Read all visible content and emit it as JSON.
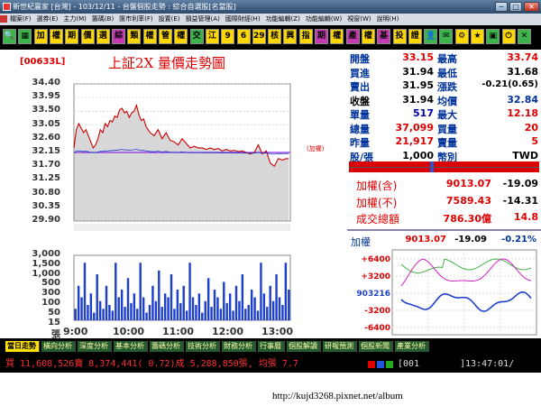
{
  "window": {
    "title": "新世紀贏家 [台灣] - 103/12/11 - 台盤個股走勢 : 綜合自選股[名當股]"
  },
  "menu": [
    "檔案(F)",
    "選券(E)",
    "主力(M)",
    "籌碼(B)",
    "匯市利率(F)",
    "設置(E)",
    "損益管理(A)",
    "國際財經(H)",
    "功能編輯(Z)",
    "功能編輯(W)",
    "視窗(W)",
    "說明(H)"
  ],
  "toolbar": [
    {
      "label": "🔍",
      "color": "#3cb44b",
      "icon": "search-icon"
    },
    {
      "label": "▦",
      "color": "#3cb44b",
      "icon": "grid-icon"
    },
    {
      "label": "加",
      "color": "#ffd700"
    },
    {
      "label": "權",
      "color": "#ffd700"
    },
    {
      "label": "期",
      "color": "#ffd700"
    },
    {
      "label": "價",
      "color": "#ffd700"
    },
    {
      "label": "選",
      "color": "#ffd700"
    },
    {
      "label": "綜",
      "color": "#c43bb0"
    },
    {
      "label": "類",
      "color": "#ffd700"
    },
    {
      "label": "權",
      "color": "#ffd700"
    },
    {
      "label": "管",
      "color": "#ffd700"
    },
    {
      "label": "權",
      "color": "#ffd700"
    },
    {
      "label": "交",
      "color": "#3cb44b"
    },
    {
      "label": "江",
      "color": "#ffd700"
    },
    {
      "label": "9",
      "color": "#ffd700"
    },
    {
      "label": "6",
      "color": "#ffd700"
    },
    {
      "label": "29",
      "color": "#ffd700"
    },
    {
      "label": "核",
      "color": "#ffd700"
    },
    {
      "label": "興",
      "color": "#ffd700"
    },
    {
      "label": "指",
      "color": "#ffd700"
    },
    {
      "label": "期",
      "color": "#c43bb0"
    },
    {
      "label": "權",
      "color": "#ffd700"
    },
    {
      "label": "產",
      "color": "#c43bb0"
    },
    {
      "label": "權",
      "color": "#ffd700"
    },
    {
      "label": "基",
      "color": "#c43bb0"
    },
    {
      "label": "投",
      "color": "#ffd700"
    },
    {
      "label": "證",
      "color": "#ffd700"
    },
    {
      "label": "👤",
      "color": "#3cb44b",
      "icon": "user-icon"
    },
    {
      "label": "✉",
      "color": "#3cb44b",
      "icon": "mail-icon"
    },
    {
      "label": "⚙",
      "color": "#ffd700",
      "icon": "gear-icon"
    },
    {
      "label": "★",
      "color": "#ffd700",
      "icon": "star-icon"
    },
    {
      "label": "▣",
      "color": "#3cb44b",
      "icon": "window-icon"
    },
    {
      "label": "⏻",
      "color": "#ffd700",
      "icon": "power-icon"
    },
    {
      "label": "✕",
      "color": "#3cb44b",
      "icon": "close-icon"
    }
  ],
  "chart_panel": {
    "code": "00633L",
    "title": "上証2X  量價走勢圖",
    "ref_label": "(加權)"
  },
  "quote": [
    {
      "label": "開盤",
      "value": "33.15",
      "color": "#d00",
      "label2": "最高",
      "value2": "33.74",
      "color2": "#d00"
    },
    {
      "label": "買進",
      "value": "31.94",
      "color": "#000",
      "label2": "最低",
      "value2": "31.68",
      "color2": "#000"
    },
    {
      "label": "賣出",
      "value": "31.95",
      "color": "#000",
      "label2": "漲跌",
      "value2": "-0.21(0.65)",
      "color2": "#000"
    },
    {
      "label": "收盤",
      "value": "31.94",
      "color": "#000",
      "label2": "均價",
      "value2": "32.84",
      "color2": "#003399",
      "bold": true
    },
    {
      "label": "單量",
      "value": "517",
      "color": "#00a",
      "label2": "最大",
      "value2": "12.18",
      "color2": "#d00"
    },
    {
      "label": "總量",
      "value": "37,099",
      "color": "#d00",
      "label2": "買量",
      "value2": "20",
      "color2": "#d00"
    },
    {
      "label": "昨量",
      "value": "21,917",
      "color": "#d00",
      "label2": "賣量",
      "value2": "5",
      "color2": "#d00"
    },
    {
      "label": "股/張",
      "value": "1,000",
      "color": "#000",
      "label2": "幣別",
      "value2": "TWD",
      "color2": "#000"
    }
  ],
  "index_summary": [
    {
      "label": "加權(含)",
      "value": "9013.07",
      "change": "-19.09"
    },
    {
      "label": "加權(不)",
      "value": "7589.43",
      "change": "-14.31"
    },
    {
      "label": "成交總額",
      "value": "786.30億",
      "change": "14.8"
    }
  ],
  "mini_chart": {
    "label": "加權",
    "value": "9013.07",
    "change": "-19.09",
    "pct": "-0.21%",
    "axis_labels": [
      "+6400",
      "+3200",
      "903216",
      "-3200",
      "-6400"
    ]
  },
  "chart_data": {
    "type": "line",
    "title": "上証2X  量價走勢圖",
    "y_ticks": [
      "34.40",
      "33.95",
      "33.50",
      "33.05",
      "32.60",
      "32.15",
      "31.70",
      "31.25",
      "30.80",
      "30.35",
      "29.90"
    ],
    "ylim": [
      29.9,
      34.4
    ],
    "reference": 32.15,
    "x_ticks": [
      "9:00",
      "10:00",
      "11:00",
      "12:00",
      "13:00"
    ],
    "series": [
      {
        "name": "price",
        "color": "#cc0000",
        "x": [
          0,
          3,
          6,
          9,
          12,
          15,
          18,
          21,
          24,
          27,
          30,
          33,
          36,
          39,
          42,
          45,
          48,
          51,
          54,
          57,
          60,
          63,
          66,
          69,
          72,
          75,
          78,
          81,
          84,
          87,
          90,
          95,
          100,
          105,
          110,
          115,
          120,
          125,
          130,
          135,
          140,
          145,
          150,
          155,
          160,
          165,
          170,
          175,
          180,
          185,
          190,
          195,
          200,
          205,
          210,
          215,
          220,
          225,
          230,
          235,
          240,
          245,
          250,
          255,
          260,
          265,
          268
        ],
        "values": [
          32.3,
          32.9,
          33.1,
          32.95,
          32.8,
          32.9,
          32.7,
          32.5,
          32.3,
          32.4,
          32.6,
          32.9,
          32.8,
          33.1,
          33.0,
          33.2,
          33.15,
          33.35,
          33.3,
          33.55,
          33.6,
          33.45,
          33.5,
          33.3,
          33.45,
          33.5,
          33.7,
          33.4,
          33.2,
          33.25,
          33.0,
          32.8,
          32.7,
          32.9,
          32.6,
          32.8,
          32.55,
          32.5,
          32.4,
          32.6,
          32.45,
          32.3,
          32.35,
          32.3,
          32.3,
          32.25,
          32.3,
          32.25,
          32.28,
          32.2,
          32.25,
          32.2,
          32.22,
          32.18,
          32.2,
          32.15,
          32.1,
          32.15,
          32.4,
          32.1,
          32.2,
          31.8,
          31.7,
          31.95,
          31.9,
          31.95,
          31.94
        ]
      }
    ],
    "volume": {
      "y_ticks": [
        "3,000",
        "1,500",
        "1,000",
        "500",
        "300",
        "100",
        "50",
        "15",
        "張"
      ],
      "values": [
        300,
        900,
        600,
        1500,
        400,
        700,
        200,
        1200,
        500,
        300,
        900,
        400,
        250,
        1500,
        600,
        800,
        350,
        1100,
        450,
        700,
        300,
        1500,
        600,
        200,
        400,
        900,
        500,
        1300,
        350,
        700,
        600,
        1200,
        300,
        800,
        450,
        900,
        250,
        1500,
        600,
        400,
        700,
        200,
        500,
        1100,
        350,
        800,
        600,
        300,
        1000,
        450,
        700,
        250,
        900,
        500,
        1200,
        300,
        400,
        800,
        600,
        250,
        1500,
        700,
        350,
        900,
        500,
        1200,
        600,
        400,
        1500,
        800
      ]
    }
  },
  "tabs": [
    "當日走勢",
    "橫向分析",
    "深度分析",
    "基本分析",
    "籌碼分析",
    "技術分析",
    "財務分析",
    "行事曆",
    "個股解讀",
    "研報預測",
    "個股新聞",
    "產業分析"
  ],
  "status": {
    "summary": "買 11,608,526賣 8,374,441( 0.72)成 5,288,850張, 均張 7.7",
    "code": "[001",
    "clock": "]13:47:01/"
  },
  "watermark": "http://kujd3268.pixnet.net/album"
}
